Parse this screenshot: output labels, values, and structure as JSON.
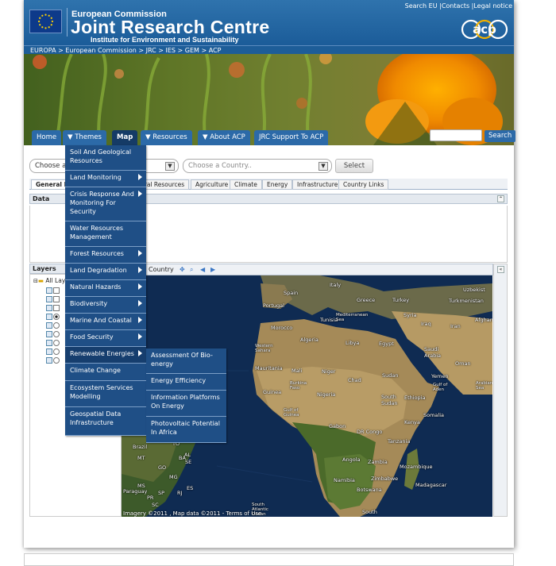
{
  "header": {
    "org": "European Commission",
    "title": "Joint Research Centre",
    "subtitle": "Institute for Environment and Sustainability",
    "top_links": [
      "Search EU",
      "Contacts",
      "Legal notice"
    ],
    "logo_text": "acp"
  },
  "breadcrumb": "EUROPA > European Commission > JRC > IES > GEM > ACP",
  "nav": {
    "items": [
      {
        "label": "Home"
      },
      {
        "label": "▼ Themes"
      },
      {
        "label": "Map",
        "active": true
      },
      {
        "label": "▼ Resources"
      },
      {
        "label": "▼ About ACP"
      },
      {
        "label": "JRC Support To ACP"
      }
    ],
    "search_button": "Search"
  },
  "selectors": {
    "region_value": "Choose a",
    "country_placeholder": "Choose a Country..",
    "select_button": "Select"
  },
  "tabs": [
    "General I",
    "ural Resources",
    "Agriculture",
    "Climate",
    "Energy",
    "Infrastructure",
    "Country Links"
  ],
  "data_panel": {
    "title": "Data"
  },
  "layers_panel": {
    "title": "Layers",
    "root": "All Lay"
  },
  "map": {
    "toolbar_label": "Country",
    "credit": "Imagery ©2011 , Map data ©2011 - Terms of Use",
    "labels": [
      "Italy",
      "Spain",
      "Portugal",
      "Greece",
      "Turkey",
      "Uzbekist",
      "Turkmenistan",
      "Tunisia",
      "Mediterranean Sea",
      "Syria",
      "Iraq",
      "Iran",
      "Afghan",
      "Morocco",
      "Algeria",
      "Libya",
      "Egypt",
      "Saudi Arabia",
      "Oman",
      "Western Sahara",
      "Mauritania",
      "Mali",
      "Niger",
      "Chad",
      "Sudan",
      "Yemen",
      "Gulf of Aden",
      "Arabian Sea",
      "Burkina Faso",
      "Guinea",
      "Nigeria",
      "South Sudan",
      "Ethiopia",
      "Somalia",
      "Kenya",
      "Gulf of Guinea",
      "Gabon",
      "DR Congo",
      "Tanzania",
      "Angola",
      "Zambia",
      "Mozambique",
      "Namibia",
      "Zimbabwe",
      "Botswana",
      "Madagascar",
      "South",
      "Brazil",
      "Paraguay",
      "South Atlantic Ocean",
      "PE",
      "AL",
      "SE",
      "BA",
      "GO",
      "MG",
      "MT",
      "TO",
      "MS",
      "SP",
      "ES",
      "PR",
      "SC",
      "RJ"
    ]
  },
  "themes_menu": [
    {
      "label": "Soil And Geological Resources",
      "arrow": false
    },
    {
      "label": "Land Monitoring",
      "arrow": true
    },
    {
      "label": "Crisis Response And Monitoring For Security",
      "arrow": true
    },
    {
      "label": "Water Resources Management",
      "arrow": false
    },
    {
      "label": "Forest Resources",
      "arrow": true
    },
    {
      "label": "Land Degradation",
      "arrow": true
    },
    {
      "label": "Natural Hazards",
      "arrow": true
    },
    {
      "label": "Biodiversity",
      "arrow": true
    },
    {
      "label": "Marine And Coastal",
      "arrow": true
    },
    {
      "label": "Food Security",
      "arrow": true
    },
    {
      "label": "Renewable Energies",
      "arrow": true
    },
    {
      "label": "Climate Change",
      "arrow": false
    },
    {
      "label": "Ecosystem Services Modelling",
      "arrow": false
    },
    {
      "label": "Geospatial Data Infrastructure",
      "arrow": false
    }
  ],
  "energy_submenu": [
    "Assessment Of Bio-energy",
    "Energy Efficiency",
    "Information Platforms On Energy",
    "Photovoltaic Potential In Africa"
  ],
  "colors": {
    "header_blue": "#1b5c99",
    "nav_blue": "#2c6aa8",
    "menu_blue": "#1f4f86",
    "nav_active": "#153b66"
  }
}
